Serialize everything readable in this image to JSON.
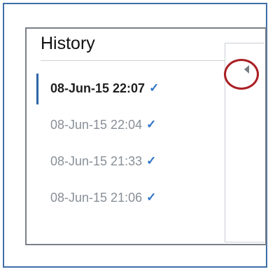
{
  "panel": {
    "title": "History"
  },
  "history": {
    "items": [
      {
        "label": "08-Jun-15 22:07",
        "active": true
      },
      {
        "label": "08-Jun-15 22:04",
        "active": false
      },
      {
        "label": "08-Jun-15 21:33",
        "active": false
      },
      {
        "label": "08-Jun-15 21:06",
        "active": false
      }
    ],
    "check_glyph": "✓"
  },
  "colors": {
    "frame_border": "#3f6ea8",
    "panel_border": "#7a7f88",
    "active_indicator": "#2d66a8",
    "check": "#2d73c7",
    "highlight": "#aa1f24",
    "inactive_text": "#888f97"
  },
  "icons": {
    "collapse": "collapse-left-icon",
    "check": "check-icon"
  }
}
